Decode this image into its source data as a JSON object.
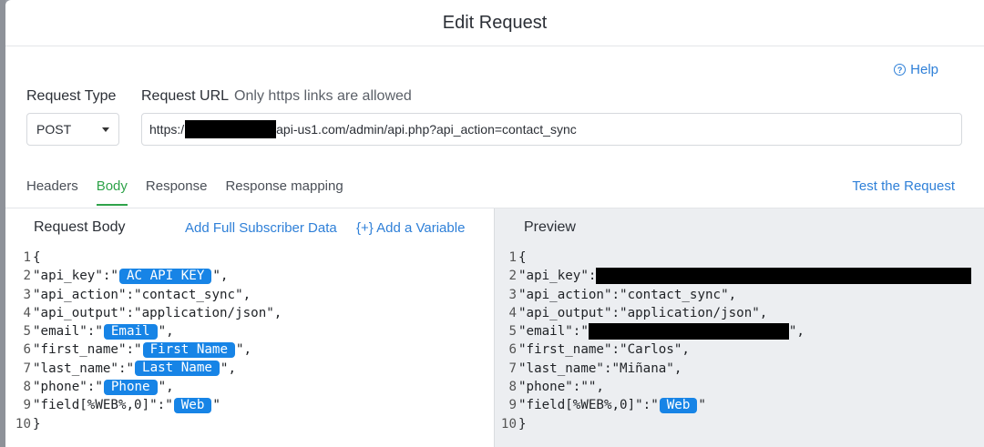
{
  "modal": {
    "title": "Edit Request"
  },
  "help": {
    "label": "Help"
  },
  "request_type": {
    "label": "Request Type",
    "value": "POST"
  },
  "request_url": {
    "label": "Request URL",
    "note": "Only https links are allowed",
    "prefix": "https:/",
    "suffix": "api-us1.com/admin/api.php?api_action=contact_sync"
  },
  "tabs": [
    {
      "label": "Headers",
      "active": false
    },
    {
      "label": "Body",
      "active": true
    },
    {
      "label": "Response",
      "active": false
    },
    {
      "label": "Response mapping",
      "active": false
    }
  ],
  "test_request": {
    "label": "Test the Request"
  },
  "request_body": {
    "title": "Request Body",
    "add_full_label": "Add Full Subscriber Data",
    "add_variable_label": "{+} Add a Variable",
    "lines": [
      {
        "n": "1",
        "a": "{",
        "var": "",
        "b": ""
      },
      {
        "n": "2",
        "a": "\"api_key\":\"",
        "var": "AC API KEY",
        "b": "\","
      },
      {
        "n": "3",
        "a": "\"api_action\":\"contact_sync\",",
        "var": "",
        "b": ""
      },
      {
        "n": "4",
        "a": "\"api_output\":\"application/json\",",
        "var": "",
        "b": ""
      },
      {
        "n": "5",
        "a": "\"email\":\"",
        "var": "Email",
        "b": "\","
      },
      {
        "n": "6",
        "a": "\"first_name\":\"",
        "var": "First Name",
        "b": "\","
      },
      {
        "n": "7",
        "a": "\"last_name\":\"",
        "var": "Last Name",
        "b": "\","
      },
      {
        "n": "8",
        "a": "\"phone\":\"",
        "var": "Phone",
        "b": "\","
      },
      {
        "n": "9",
        "a": "\"field[%WEB%,0]\":\"",
        "var": "Web",
        "b": "\""
      },
      {
        "n": "10",
        "a": "}",
        "var": "",
        "b": ""
      }
    ]
  },
  "preview": {
    "title": "Preview",
    "lines": [
      {
        "n": "1",
        "a": "{",
        "var": "",
        "b": ""
      },
      {
        "n": "2",
        "a": "\"api_key\":",
        "var": "",
        "b": ""
      },
      {
        "n": "3",
        "a": "\"api_action\":\"contact_sync\",",
        "var": "",
        "b": ""
      },
      {
        "n": "4",
        "a": "\"api_output\":\"application/json\",",
        "var": "",
        "b": ""
      },
      {
        "n": "5",
        "a": "\"email\":\"",
        "var": "",
        "b": "\","
      },
      {
        "n": "6",
        "a": "\"first_name\":\"Carlos\",",
        "var": "",
        "b": ""
      },
      {
        "n": "7",
        "a": "\"last_name\":\"Miñana\",",
        "var": "",
        "b": ""
      },
      {
        "n": "8",
        "a": "\"phone\":\"\",",
        "var": "",
        "b": ""
      },
      {
        "n": "9",
        "a": "\"field[%WEB%,0]\":\"",
        "var": "Web",
        "b": "\""
      },
      {
        "n": "10",
        "a": "}",
        "var": "",
        "b": ""
      }
    ]
  },
  "colors": {
    "accent": "#2f80d8",
    "active_tab": "#2fa34a",
    "variable_chip": "#1784e6"
  }
}
